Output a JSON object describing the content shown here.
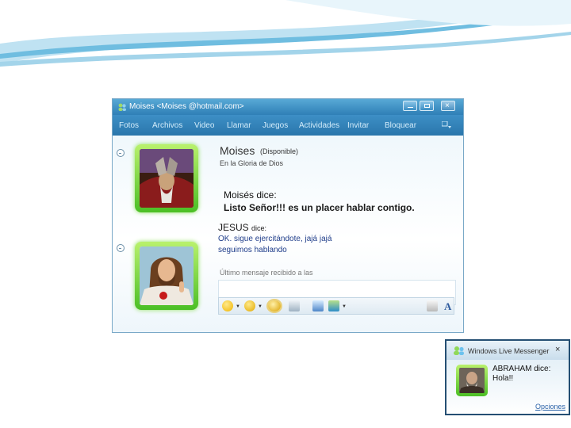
{
  "window": {
    "title": "Moises <Moises @hotmail.com>"
  },
  "menu": {
    "items": [
      "Fotos",
      "Archivos",
      "Video",
      "Llamar",
      "Juegos",
      "Actividades",
      "Invitar",
      "Bloquear"
    ]
  },
  "contact": {
    "name": "Moises",
    "status": "(Disponible)",
    "personal_message": "En la Gloria de Dios"
  },
  "messages": [
    {
      "sender": "Moisés dice",
      "text": "Listo Señor!!! es un placer hablar contigo."
    },
    {
      "sender": "JESUS",
      "says": "dice:",
      "lines": [
        "OK.  sigue ejercitándote, jajá jajá",
        "seguimos hablando"
      ]
    }
  ],
  "last_message": "Último mensaje recibido a las",
  "toolbar": {
    "font_icon": "A",
    "buttons": [
      "emoticon-icon",
      "wink-icon",
      "nudge-icon",
      "voice-clip-icon",
      "font-icon",
      "background-icon",
      "handwriting-icon",
      "text-icon"
    ]
  },
  "notification": {
    "title": "Windows Live Messenger",
    "close": "×",
    "line1": "ABRAHAM dice:",
    "line2": "Hola!!",
    "options_link": "Opciones"
  },
  "colors": {
    "titlebar": "#3e8fc7",
    "avatar_frame": "#5cc92f",
    "link": "#2a62a8"
  }
}
